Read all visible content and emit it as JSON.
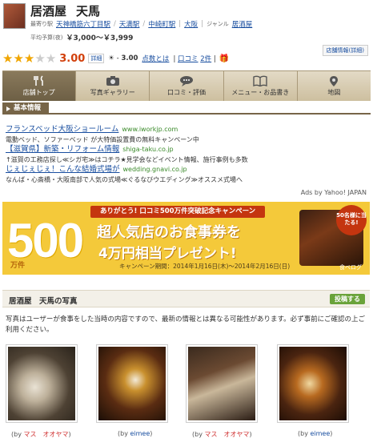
{
  "header": {
    "shop_name_1": "居酒屋",
    "shop_name_2": "天馬",
    "nearest_label": "最寄り駅",
    "stations": [
      "天神橋筋六丁目駅",
      "天満駅",
      "中崎町駅"
    ],
    "area": "大阪",
    "genre_label": "ジャンル",
    "genre": "居酒屋",
    "budget_label": "平均予算(夜)",
    "price": "￥3,000〜￥3,999",
    "sponsor_link": "店舗情報(詳細)"
  },
  "rating": {
    "stars_total": 5,
    "stars_filled": 3,
    "score": "3.00",
    "detail_label": "詳細",
    "lunch_score": "3.00",
    "points_label": "点数とは",
    "review_label": "口コミ",
    "review_count": "2件"
  },
  "tabs": [
    {
      "label": "店舗トップ",
      "icon": "fork-knife-icon",
      "active": true
    },
    {
      "label": "写真ギャラリー",
      "icon": "camera-icon",
      "active": false
    },
    {
      "label": "口コミ・評価",
      "icon": "speech-bubble-icon",
      "active": false
    },
    {
      "label": "メニュー・お品書き",
      "icon": "book-icon",
      "active": false
    },
    {
      "label": "地図",
      "icon": "map-pin-icon",
      "active": false
    }
  ],
  "section": {
    "title": "基本情報"
  },
  "ads": [
    {
      "title": "フランスベッド大阪ショールーム",
      "url": "www.iworkjp.com",
      "desc": "電動ベッド、ソファーベッド が大特価設置費の無料キャンペーン中"
    },
    {
      "title": "【滋賀県】新築・リフォーム情報",
      "url": "shiga-taku.co.jp",
      "desc": "↑滋賀の工務店探し≪シガ宅≫はコチラ★見学会などイベント情報、施行事例も多数"
    },
    {
      "title": "じぇじぇじぇ！こんな結婚式場が",
      "url": "wedding.gnavi.co.jp",
      "desc": "なんば・心斎橋・大阪南部で人気の式場≪ぐるなびウエディング≫オススメ式場へ"
    }
  ],
  "ads_by": "Ads by Yahoo! JAPAN",
  "banner": {
    "top": "ありがとう! 口コミ500万件突破記念キャンペーン",
    "big_number": "500",
    "manken": "万件",
    "line1": "超人気店のお食事券を",
    "line2": "4万円相当プレゼント!",
    "period": "キャンペーン期間：2014年1月16日(木)〜2014年2月16日(日)",
    "badge": "50名様に当たる!",
    "brand": "食べログ"
  },
  "photos": {
    "title": "居酒屋　天馬の写真",
    "post_button": "投稿する",
    "note": "写真はユーザーが食事をした当時の内容ですので、最新の情報とは異なる可能性があります。必ず事前にご確認の上ご利用ください。",
    "items": [
      {
        "by_prefix": "(by",
        "user": "マス　オオヤマ",
        "by_suffix": ")"
      },
      {
        "by_prefix": "(by",
        "user": "eimee",
        "by_suffix": ")"
      },
      {
        "by_prefix": "(by",
        "user": "マス　オオヤマ",
        "by_suffix": ")"
      },
      {
        "by_prefix": "(by",
        "user": "eimee",
        "by_suffix": ")"
      }
    ]
  },
  "colors": {
    "accent": "#d2400c",
    "link": "#1a4fa0",
    "tab_active": "#776548",
    "banner_bg": "#f4c93a",
    "star_on": "#f0a500"
  }
}
